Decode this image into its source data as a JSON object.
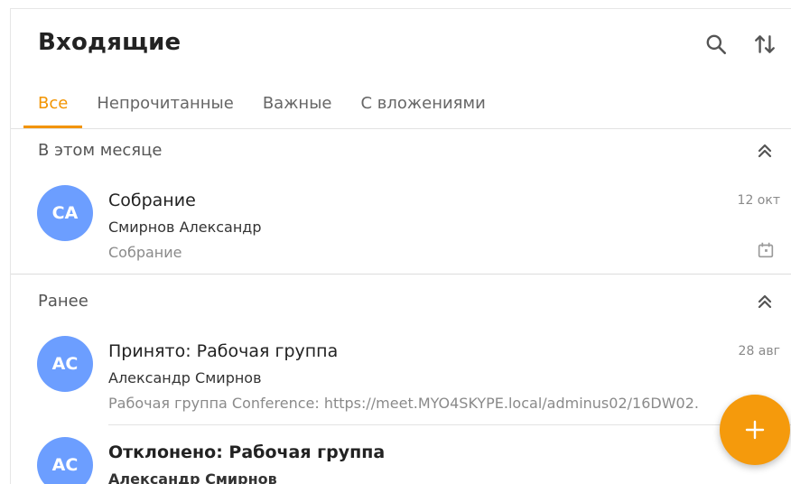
{
  "header": {
    "title": "Входящие",
    "search_icon": "search-icon",
    "sort_icon": "sort-arrows-icon"
  },
  "tabs": [
    {
      "label": "Все",
      "active": true
    },
    {
      "label": "Непрочитанные",
      "active": false
    },
    {
      "label": "Важные",
      "active": false
    },
    {
      "label": "С вложениями",
      "active": false
    }
  ],
  "sections": [
    {
      "label": "В этом месяце",
      "collapse_icon": "double-chevron-up-icon",
      "messages": [
        {
          "initials": "СА",
          "subject": "Собрание",
          "sender": "Смирнов Александр",
          "preview": "Собрание",
          "date": "12 окт",
          "icon": "calendar-icon",
          "unread": false
        }
      ]
    },
    {
      "label": "Ранее",
      "collapse_icon": "double-chevron-up-icon",
      "messages": [
        {
          "initials": "АС",
          "subject": "Принято: Рабочая группа",
          "sender": "Александр Смирнов",
          "preview": "Рабочая группа Conference: https://meet.MYO4SKYPE.local/adminus02/16DW02.",
          "date": "28 авг",
          "unread": false
        },
        {
          "initials": "АС",
          "subject": "Отклонено: Рабочая группа",
          "sender": "Александр Смирнов",
          "unread": true
        }
      ]
    }
  ],
  "fab": {
    "icon": "plus-icon"
  },
  "colors": {
    "accent": "#f29400",
    "avatar": "#6c9eff",
    "fab": "#f59a0c"
  }
}
